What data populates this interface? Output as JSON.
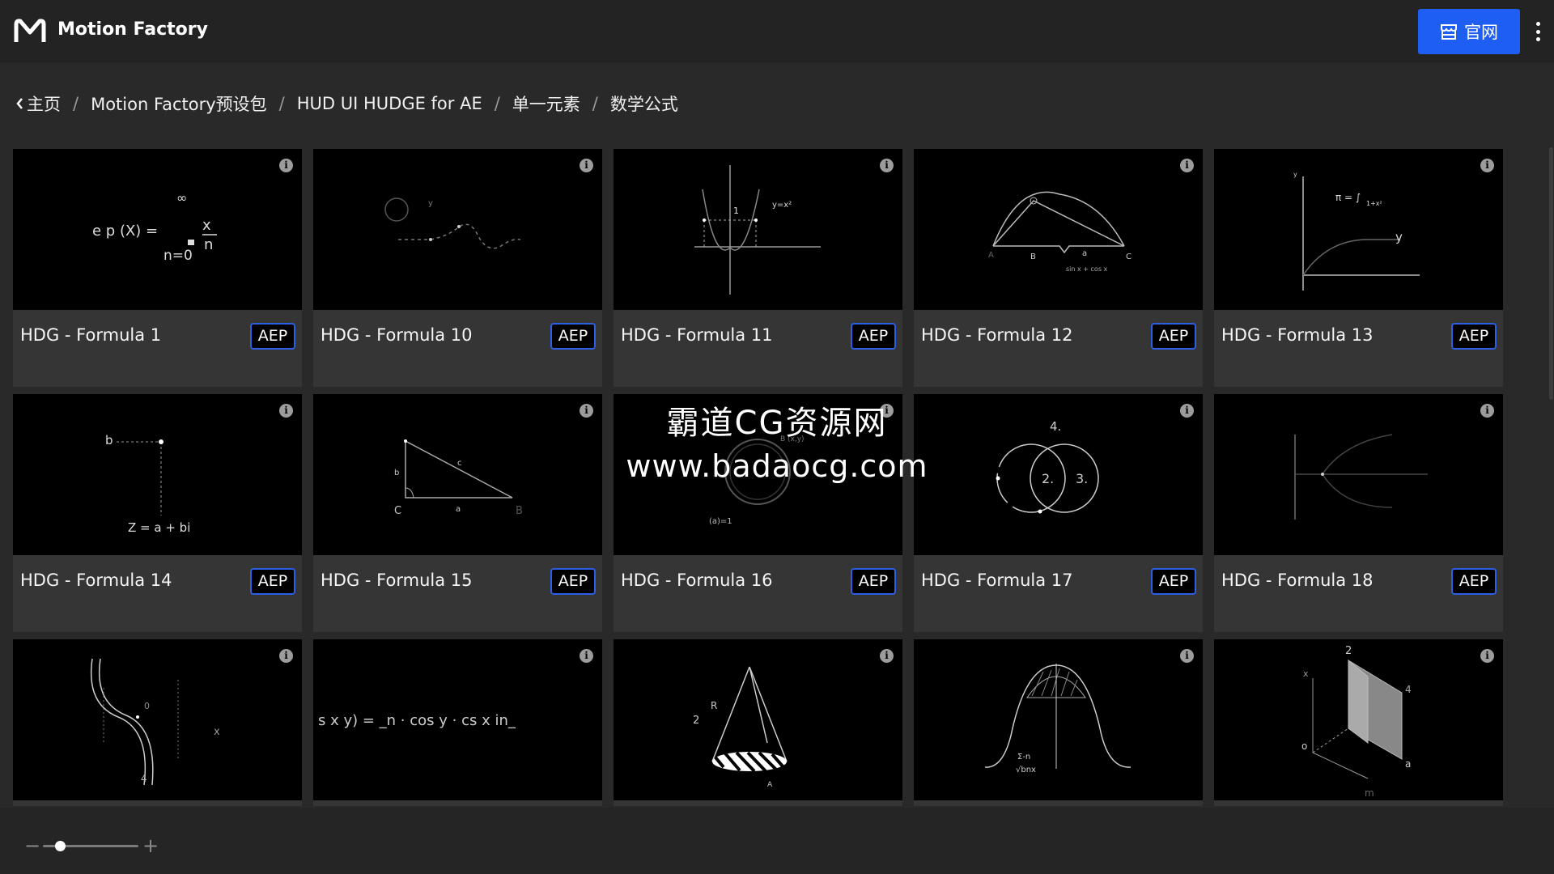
{
  "header": {
    "app_title": "Motion Factory",
    "site_button_label": "官网",
    "site_button_icon": "store-icon",
    "menu_icon": "kebab-menu-icon",
    "accent_color": "#1e5ef2"
  },
  "breadcrumb": {
    "items": [
      "主页",
      "Motion Factory预设包",
      "HUD UI HUDGE for AE",
      "单一元素",
      "数学公式"
    ],
    "separator": "/"
  },
  "cards": [
    {
      "title": "HDG - Formula 1",
      "badge": "AEP"
    },
    {
      "title": "HDG - Formula 10",
      "badge": "AEP"
    },
    {
      "title": "HDG - Formula 11",
      "badge": "AEP"
    },
    {
      "title": "HDG - Formula 12",
      "badge": "AEP"
    },
    {
      "title": "HDG - Formula 13",
      "badge": "AEP"
    },
    {
      "title": "HDG - Formula 14",
      "badge": "AEP"
    },
    {
      "title": "HDG - Formula 15",
      "badge": "AEP"
    },
    {
      "title": "HDG - Formula 16",
      "badge": "AEP"
    },
    {
      "title": "HDG - Formula 17",
      "badge": "AEP"
    },
    {
      "title": "HDG - Formula 18",
      "badge": "AEP"
    },
    {
      "title": "",
      "badge": ""
    },
    {
      "title": "",
      "badge": ""
    },
    {
      "title": "",
      "badge": ""
    },
    {
      "title": "",
      "badge": ""
    },
    {
      "title": "",
      "badge": ""
    }
  ],
  "thumb_text": {
    "f1": {
      "infinity": "∞",
      "lhs": "e p (X) =",
      "x": "x",
      "n": "n",
      "n0": "n=0"
    },
    "f10": {
      "y": "y"
    },
    "f11": {
      "one": "1",
      "eq": "y=x²"
    },
    "f12": {
      "a": "A",
      "b": "B",
      "c": "C",
      "small_a": "a",
      "expr": "sin x + cos x"
    },
    "f13": {
      "pi": "π = ∫",
      "frac": "1+x²",
      "y": "y",
      "yaxis": "y"
    },
    "f14": {
      "b": "b",
      "z": "Z = a + bi"
    },
    "f15": {
      "b": "b",
      "c": "c",
      "C": "C",
      "a": "a",
      "B": "B"
    },
    "f16": {
      "bxy": "B (x,y)",
      "a1": "(a)=1"
    },
    "f17": {
      "four": "4.",
      "two": "2.",
      "three": "3."
    },
    "f18": {},
    "f19": {
      "zero": "0",
      "x": "x",
      "four": "4"
    },
    "f20": {
      "expr": "s   x  y) = _n    · cos y      ·  cs   x    in_"
    },
    "f21": {
      "two": "2",
      "R": "R",
      "A": "A"
    },
    "f22": {
      "sum": "Σ-n",
      "root": "√bnx"
    },
    "f23": {
      "two": "2",
      "four": "4",
      "x": "x",
      "o": "o",
      "a": "a",
      "m": "m"
    }
  },
  "zoom": {
    "minus": "−",
    "plus": "+",
    "level": 0.18
  },
  "watermark": {
    "line1": "霸道CG资源网",
    "line2": "www.badaocg.com"
  }
}
